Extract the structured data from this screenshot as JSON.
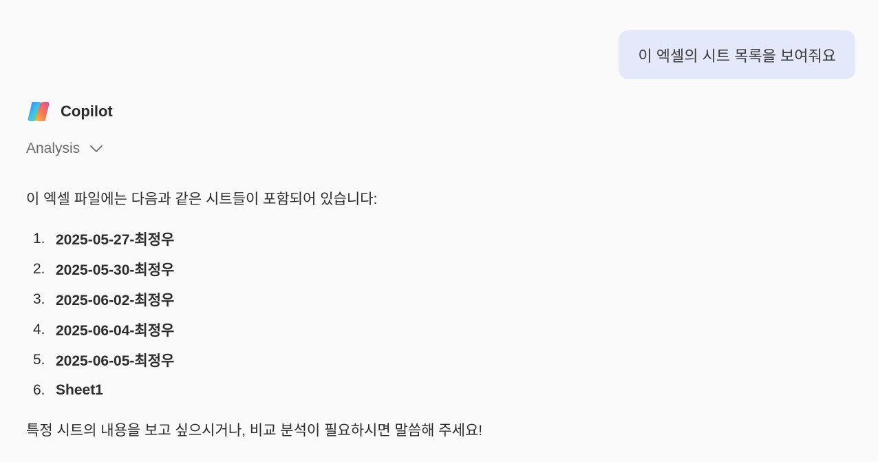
{
  "user_message": "이 엑셀의 시트 목록을 보여줘요",
  "assistant": {
    "name": "Copilot",
    "logo_icon": "copilot-logo-icon",
    "analysis_label": "Analysis",
    "intro": "이 엑셀 파일에는 다음과 같은 시트들이 포함되어 있습니다:",
    "sheets": [
      {
        "num": "1.",
        "name": "2025-05-27-최정우"
      },
      {
        "num": "2.",
        "name": "2025-05-30-최정우"
      },
      {
        "num": "3.",
        "name": "2025-06-02-최정우"
      },
      {
        "num": "4.",
        "name": "2025-06-04-최정우"
      },
      {
        "num": "5.",
        "name": "2025-06-05-최정우"
      },
      {
        "num": "6.",
        "name": "Sheet1"
      }
    ],
    "outro": "특정 시트의 내용을 보고 싶으시거나, 비교 분석이 필요하시면 말씀해 주세요!"
  },
  "colors": {
    "background": "#fafafa",
    "user_bubble": "#e4e8fb",
    "text": "#2b2b2b",
    "muted": "#6b6b6b"
  }
}
